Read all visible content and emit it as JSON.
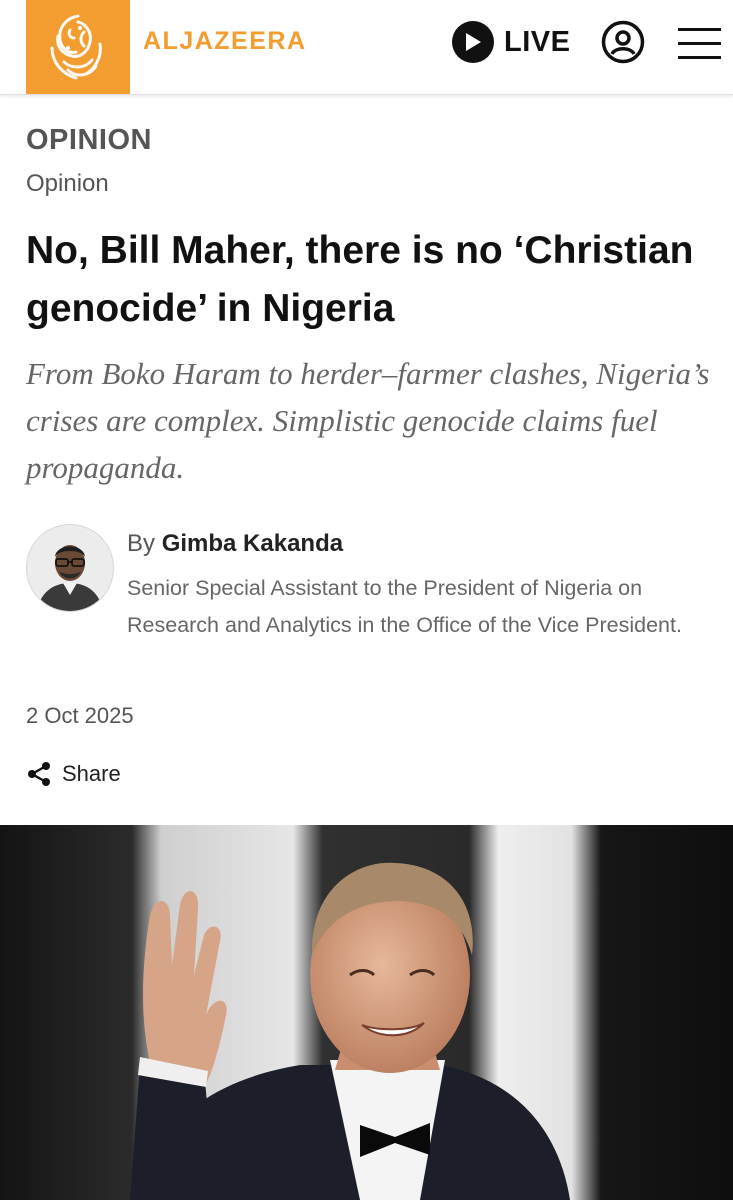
{
  "header": {
    "brand": "ALJAZEERA",
    "live_label": "LIVE",
    "colors": {
      "brand": "#f39c2f",
      "text": "#111111"
    },
    "icons": [
      "aljazeera-logo",
      "play-icon",
      "account-icon",
      "menu-icon"
    ]
  },
  "article": {
    "section": "OPINION",
    "subsection": "Opinion",
    "headline": "No, Bill Maher, there is no ‘Christian genocide’ in Nigeria",
    "dek": "From Boko Haram to herder–farmer clashes, Nigeria’s crises are complex. Simplistic genocide claims fuel propaganda.",
    "byline_prefix": "By",
    "author_name": "Gimba Kakanda",
    "author_role": "Senior Special Assistant to the President of Nigeria on Research and Analytics in the Office of the Vice President.",
    "date": "2 Oct 2025",
    "share_label": "Share"
  }
}
